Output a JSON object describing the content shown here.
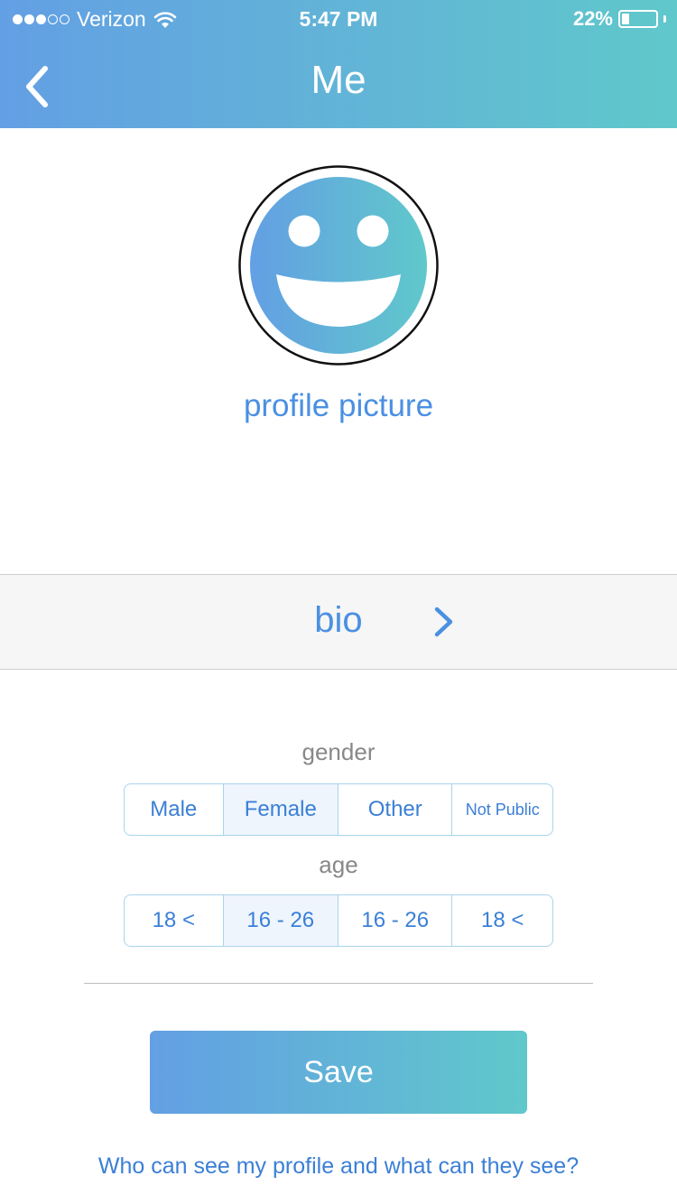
{
  "status_bar": {
    "carrier": "Verizon",
    "signal_bars_filled": 3,
    "signal_bars_total": 5,
    "time": "5:47 PM",
    "battery_percent": "22%",
    "battery_level": 0.22
  },
  "header": {
    "title": "Me",
    "back_icon": "chevron-left-icon"
  },
  "profile": {
    "avatar_icon": "smiley-face-icon",
    "label": "profile picture"
  },
  "bio": {
    "label": "bio",
    "chevron_icon": "chevron-right-icon"
  },
  "gender": {
    "label": "gender",
    "options": [
      "Male",
      "Female",
      "Other",
      "Not Public"
    ],
    "selected": "Female"
  },
  "age": {
    "label": "age",
    "options": [
      "18 <",
      "16 - 26",
      "16 - 26",
      "18 <"
    ],
    "selected_index": 1
  },
  "actions": {
    "save_label": "Save",
    "privacy_link": "Who can see my profile and what can they see?"
  },
  "colors": {
    "gradient_start": "#639fe4",
    "gradient_end": "#60c8cb",
    "accent_blue": "#4a90e2",
    "label_gray": "#888888",
    "segment_border": "#a9d3ee"
  }
}
